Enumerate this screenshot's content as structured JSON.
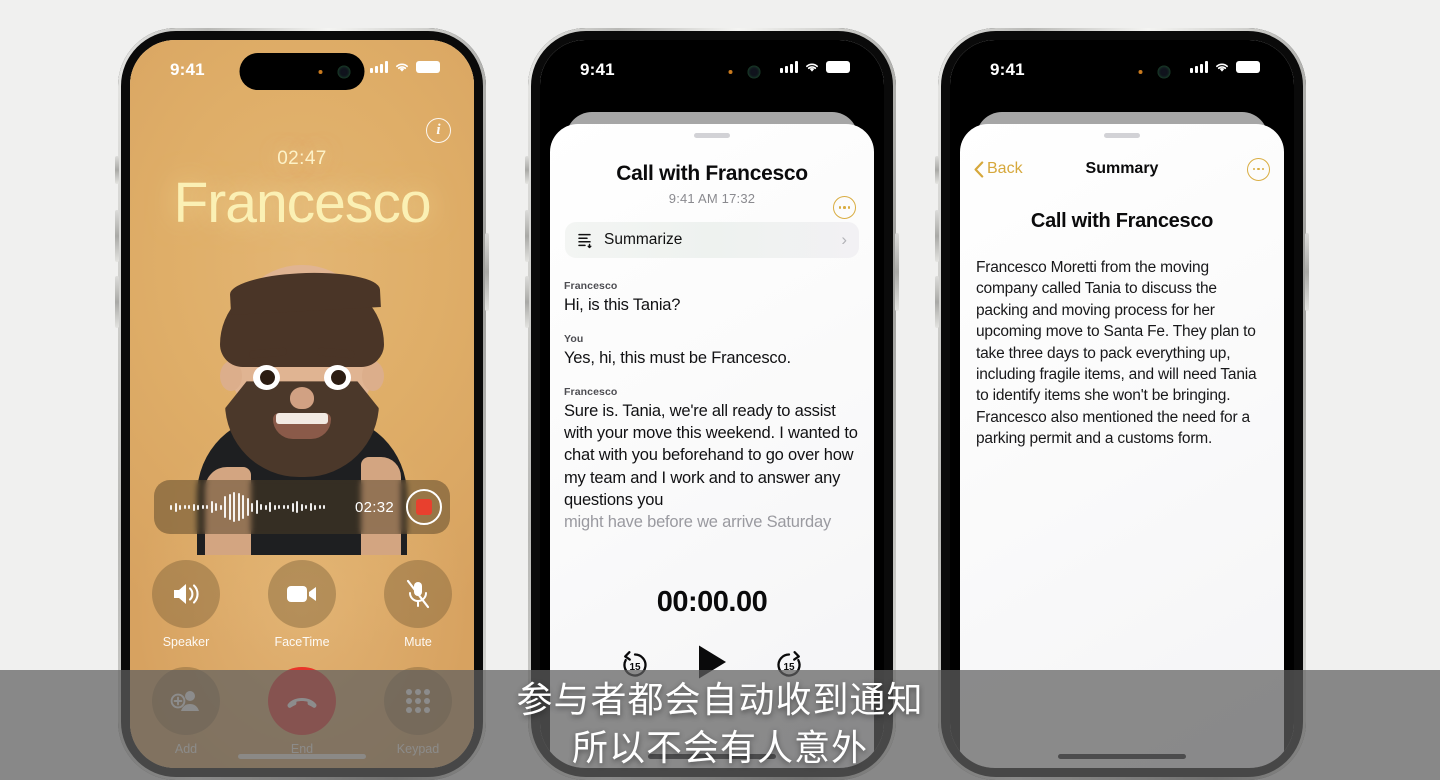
{
  "background_color": "#f0f0ef",
  "phones": {
    "phone1": {
      "name": "active-call-screen",
      "status_bar": {
        "time": "9:41",
        "signal_icon": "cellular-bars-icon",
        "wifi_icon": "wifi-icon",
        "battery_icon": "battery-icon"
      },
      "info_button": "i",
      "call_timer": "02:47",
      "caller_name": "Francesco",
      "avatar": "memoji-avatar",
      "background_color": "#d9a661",
      "recording": {
        "time": "02:32",
        "waveform_icon": "audio-waveform-icon",
        "stop_button": "stop-recording-button"
      },
      "controls": [
        {
          "label": "Speaker",
          "icon": "speaker-icon"
        },
        {
          "label": "FaceTime",
          "icon": "video-camera-icon"
        },
        {
          "label": "Mute",
          "icon": "microphone-muted-icon"
        },
        {
          "label": "Add",
          "icon": "add-person-icon"
        },
        {
          "label": "End",
          "icon": "end-call-icon"
        },
        {
          "label": "Keypad",
          "icon": "keypad-icon"
        }
      ],
      "end_button_color": "#e8342a"
    },
    "phone2": {
      "name": "call-transcript-sheet",
      "status_bar": {
        "time": "9:41",
        "signal_icon": "cellular-bars-icon",
        "wifi_icon": "wifi-icon",
        "battery_icon": "battery-icon"
      },
      "sheet_title": "Call with Francesco",
      "sheet_subtitle": "9:41 AM  17:32",
      "more_button": "more-options-button",
      "summarize": {
        "label": "Summarize",
        "icon": "summarize-icon",
        "chevron": "›"
      },
      "transcript": [
        {
          "speaker": "Francesco",
          "text": "Hi, is this Tania?",
          "faded": false
        },
        {
          "speaker": "You",
          "text": "Yes, hi, this must be Francesco.",
          "faded": false
        },
        {
          "speaker": "Francesco",
          "text": "Sure is. Tania, we're all ready to assist with your move this weekend. I wanted to chat with you beforehand to go over how my team and I work and to answer any questions you",
          "faded": false
        },
        {
          "speaker": "",
          "text": "might have before we arrive Saturday",
          "faded": true
        }
      ],
      "player": {
        "time": "00:00.00",
        "skip_back": "15",
        "play_icon": "play-icon",
        "skip_forward": "15"
      }
    },
    "phone3": {
      "name": "call-summary-screen",
      "status_bar": {
        "time": "9:41",
        "signal_icon": "cellular-bars-icon",
        "wifi_icon": "wifi-icon",
        "battery_icon": "battery-icon"
      },
      "back_label": "Back",
      "nav_title": "Summary",
      "more_button": "more-options-button",
      "summary_title": "Call with Francesco",
      "summary_body": "Francesco Moretti from the moving company called Tania to discuss the packing and moving process for her upcoming move to Santa Fe. They plan to take three days to pack everything up, including fragile items, and will need Tania to identify items she won't be bringing. Francesco also mentioned the need for a parking permit and a customs form.",
      "accent_color": "#d9ad42"
    }
  },
  "subtitles": {
    "line1": "参与者都会自动收到通知",
    "line2": "所以不会有人意外"
  }
}
